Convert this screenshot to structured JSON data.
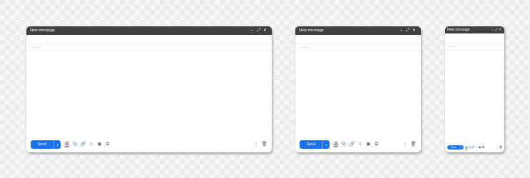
{
  "compose_windows": [
    {
      "title": "New message",
      "controls": {
        "minimize": "–",
        "expand": "⤢",
        "close": "✕"
      },
      "to_placeholder": "",
      "subject_placeholder": "Subject",
      "send_label": "Send",
      "send_options": "▾",
      "toolbar": {
        "format": "A",
        "attach": "📎",
        "link": "🔗",
        "emoji": "☺",
        "photo": "▣",
        "drive": "⧉",
        "more": "⋮",
        "discard": "🗑"
      }
    },
    {
      "title": "New message",
      "controls": {
        "minimize": "–",
        "expand": "⤢",
        "close": "✕"
      },
      "to_placeholder": "",
      "subject_placeholder": "Subject",
      "send_label": "Send",
      "send_options": "▾",
      "toolbar": {
        "format": "A",
        "attach": "📎",
        "link": "🔗",
        "emoji": "☺",
        "photo": "▣",
        "drive": "⧉",
        "more": "⋮",
        "discard": "🗑"
      }
    },
    {
      "title": "New message",
      "controls": {
        "minimize": "–",
        "expand": "⤢",
        "close": "✕"
      },
      "to_placeholder": "",
      "subject_placeholder": "Subject",
      "send_label": "Send",
      "send_options": "▾",
      "toolbar": {
        "format": "A",
        "attach": "📎",
        "link": "🔗",
        "emoji": "☺",
        "photo": "▣",
        "drive": "⧉",
        "more": "⋮",
        "discard": "🗑"
      }
    }
  ],
  "icons": [
    "minimize-icon",
    "expand-icon",
    "close-icon",
    "format-text-icon",
    "attach-icon",
    "link-icon",
    "emoji-icon",
    "photo-icon",
    "drive-icon",
    "more-options-icon",
    "trash-icon"
  ],
  "colors": {
    "titlebar": "#404040",
    "send_button": "#1a73e8",
    "background_checker": "#ececec"
  }
}
